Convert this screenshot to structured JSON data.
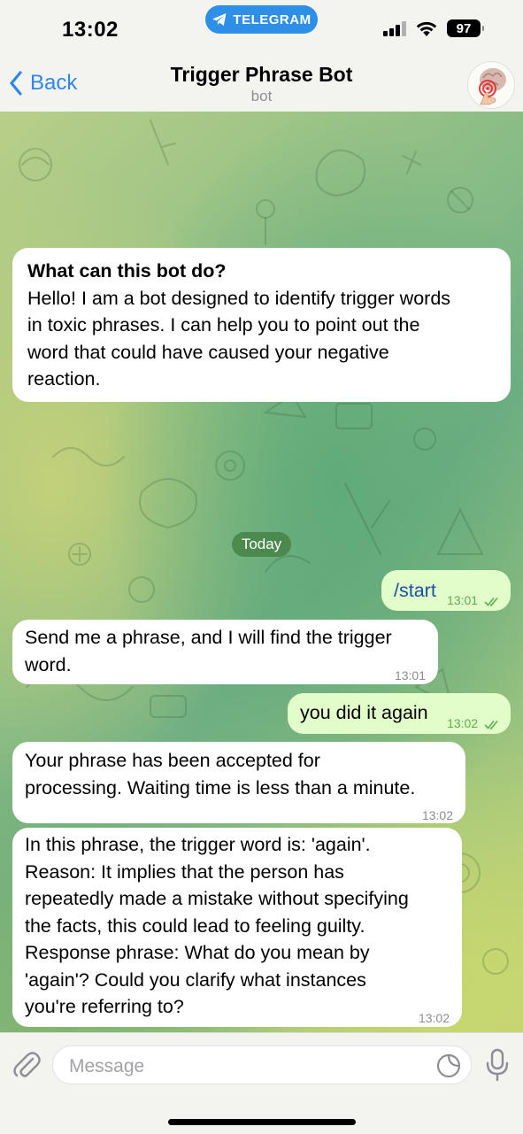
{
  "status_bar": {
    "time": "13:02",
    "app_pill": "TELEGRAM",
    "battery": "97"
  },
  "header": {
    "back_label": "Back",
    "title": "Trigger Phrase Bot",
    "subtitle": "bot"
  },
  "intro": {
    "title": "What can this bot do?",
    "lines": [
      "Hello! I am a bot designed to identify trigger words",
      "in toxic phrases. I can help you to point out the",
      "word that could have caused your negative",
      "reaction."
    ]
  },
  "date_separator": "Today",
  "messages": [
    {
      "direction": "out",
      "lines": [
        "/start"
      ],
      "time": "13:01",
      "read": true
    },
    {
      "direction": "in",
      "lines": [
        "Send me a phrase, and I will find the trigger",
        "word."
      ],
      "time": "13:01"
    },
    {
      "direction": "out",
      "lines": [
        "you did it again"
      ],
      "time": "13:02",
      "read": true
    },
    {
      "direction": "in",
      "lines": [
        "Your phrase has been accepted for",
        "processing. Waiting time is less than a minute."
      ],
      "time": "13:02"
    },
    {
      "direction": "in",
      "lines": [
        "In this phrase, the trigger word is: 'again'.",
        "Reason: It implies that the person has",
        "repeatedly made a mistake without specifying",
        "the facts, this could lead to feeling guilty.",
        "Response phrase: What do you mean by",
        "'again'? Could you clarify what instances",
        "you're referring to?"
      ],
      "time": "13:02"
    }
  ],
  "composer": {
    "placeholder": "Message"
  },
  "colors": {
    "accent": "#2f86e8",
    "outgoing_bubble": "#e2fdc9",
    "incoming_bubble": "#ffffff",
    "date_pill": "#4a8a4a"
  },
  "icons": [
    "telegram-plane-icon",
    "signal-icon",
    "wifi-icon",
    "battery-icon",
    "chevron-left-icon",
    "brain-avatar-icon",
    "double-check-icon",
    "paperclip-icon",
    "sticker-icon",
    "microphone-icon"
  ]
}
